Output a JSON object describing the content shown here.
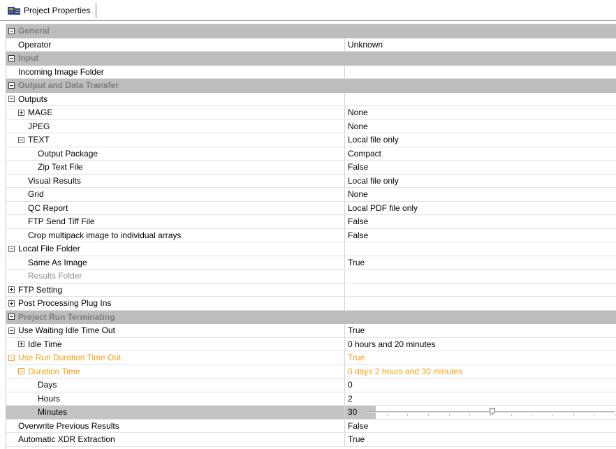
{
  "window": {
    "tab_label": "Project Properties"
  },
  "colors": {
    "category_bg": "#bdbdbd",
    "category_text": "#7d7d7d",
    "highlight": "#f3a012",
    "selected_bg": "#c4c4c4"
  },
  "rows": [
    {
      "type": "category",
      "name": "General",
      "value": "",
      "expander": "minus"
    },
    {
      "type": "prop",
      "name": "Operator",
      "value": "Unknown",
      "indent": 1
    },
    {
      "type": "category",
      "name": "Input",
      "value": "",
      "expander": "minus"
    },
    {
      "type": "prop",
      "name": "Incoming Image Folder",
      "value": "",
      "indent": 1
    },
    {
      "type": "category",
      "name": "Output and Data Transfer",
      "value": "",
      "expander": "minus"
    },
    {
      "type": "prop",
      "name": "Outputs",
      "value": "",
      "indent": 0,
      "expander": "minus"
    },
    {
      "type": "prop",
      "name": "MAGE",
      "value": "None",
      "indent": 1,
      "expander": "plus"
    },
    {
      "type": "prop",
      "name": "JPEG",
      "value": "None",
      "indent": 2
    },
    {
      "type": "prop",
      "name": "TEXT",
      "value": "Local file only",
      "indent": 1,
      "expander": "minus"
    },
    {
      "type": "prop",
      "name": "Output Package",
      "value": "Compact",
      "indent": 3
    },
    {
      "type": "prop",
      "name": "Zip Text File",
      "value": "False",
      "indent": 3
    },
    {
      "type": "prop",
      "name": "Visual Results",
      "value": "Local file only",
      "indent": 2
    },
    {
      "type": "prop",
      "name": "Grid",
      "value": "None",
      "indent": 2
    },
    {
      "type": "prop",
      "name": "QC Report",
      "value": "Local PDF file only",
      "indent": 2
    },
    {
      "type": "prop",
      "name": "FTP Send Tiff File",
      "value": "False",
      "indent": 2
    },
    {
      "type": "prop",
      "name": "Crop multipack image to individual arrays",
      "value": "False",
      "indent": 2
    },
    {
      "type": "prop",
      "name": "Local File Folder",
      "value": "",
      "indent": 0,
      "expander": "minus"
    },
    {
      "type": "prop",
      "name": "Same As Image",
      "value": "True",
      "indent": 2
    },
    {
      "type": "prop",
      "name": "Results Folder",
      "value": "",
      "indent": 2,
      "dim": true
    },
    {
      "type": "prop",
      "name": "FTP Setting",
      "value": "",
      "indent": 0,
      "expander": "plus"
    },
    {
      "type": "prop",
      "name": "Post Processing Plug Ins",
      "value": "",
      "indent": 0,
      "expander": "plus"
    },
    {
      "type": "category",
      "name": "Project Run Terminating",
      "value": "",
      "expander": "minus"
    },
    {
      "type": "prop",
      "name": "Use Waiting  Idle Time Out",
      "value": "True",
      "indent": 0,
      "expander": "minus"
    },
    {
      "type": "prop",
      "name": "Idle Time",
      "value": "0 hours and 20 minutes",
      "indent": 1,
      "expander": "plus"
    },
    {
      "type": "prop",
      "name": "Use Run Duration Time Out",
      "value": "True",
      "indent": 0,
      "expander": "minus",
      "highlight": true
    },
    {
      "type": "prop",
      "name": "Duration Time",
      "value": "0 days 2 hours and 30 minutes",
      "indent": 1,
      "expander": "minus",
      "highlight": true
    },
    {
      "type": "prop",
      "name": "Days",
      "value": "0",
      "indent": 3
    },
    {
      "type": "prop",
      "name": "Hours",
      "value": "2",
      "indent": 3
    },
    {
      "type": "prop",
      "name": "Minutes",
      "value": "30",
      "indent": 3,
      "selected": true,
      "slider": {
        "min": 0,
        "max": 59,
        "value": 30
      }
    },
    {
      "type": "prop",
      "name": "Overwrite Previous Results",
      "value": "False",
      "indent": 1
    },
    {
      "type": "prop",
      "name": "Automatic XDR Extraction",
      "value": "True",
      "indent": 1
    }
  ]
}
